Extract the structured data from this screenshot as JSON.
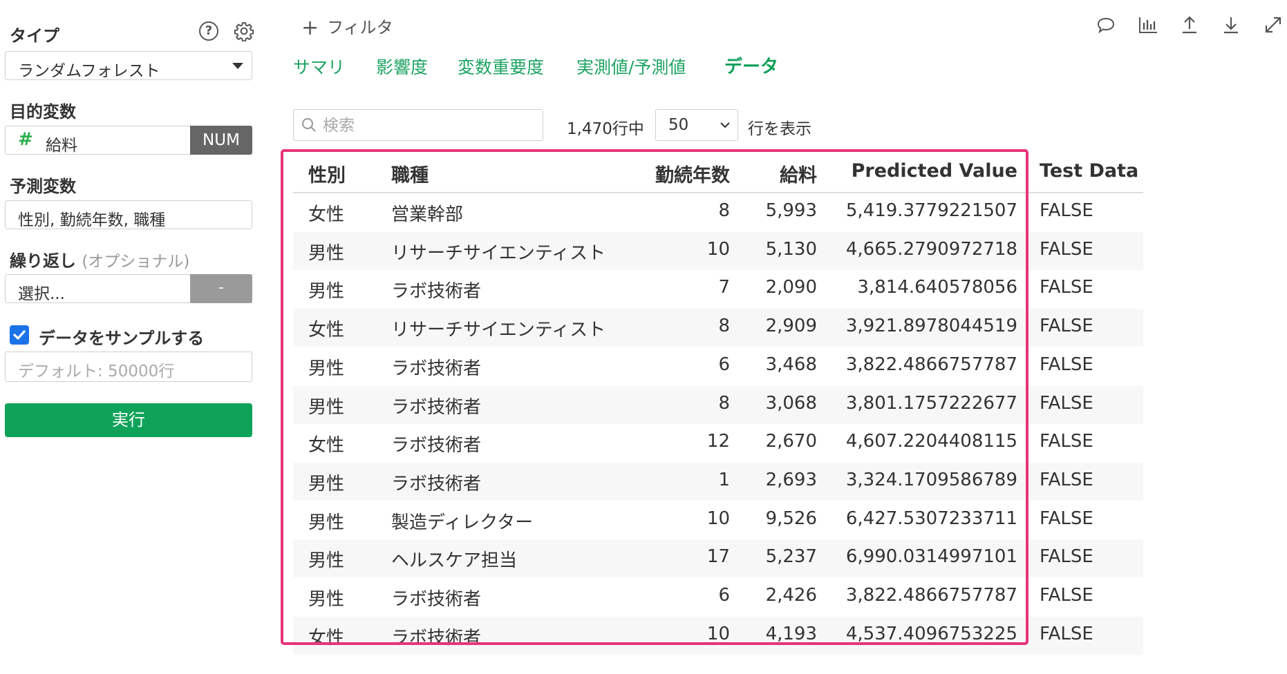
{
  "sidebar": {
    "type_label": "タイプ",
    "type_value": "ランダムフォレスト",
    "target_label": "目的変数",
    "target_value": "給料",
    "target_type_badge": "NUM",
    "predictors_label": "予測変数",
    "predictors_value": "性別, 勤続年数, 職種",
    "repeat_label": "繰り返し",
    "repeat_optional": "(オプショナル)",
    "repeat_value": "選択...",
    "repeat_button": "-",
    "sample_label": "データをサンプルする",
    "sample_checked": true,
    "sample_placeholder": "デフォルト: 50000行",
    "run_label": "実行"
  },
  "toolbar": {
    "filter_label": "フィルタ",
    "icons": [
      "comment-icon",
      "chart-icon",
      "upload-icon",
      "download-icon",
      "expand-icon"
    ]
  },
  "tabs": [
    {
      "label": "サマリ",
      "active": false
    },
    {
      "label": "影響度",
      "active": false
    },
    {
      "label": "変数重要度",
      "active": false
    },
    {
      "label": "実測値/予測値",
      "active": false
    },
    {
      "label": "データ",
      "active": true
    }
  ],
  "data_view": {
    "search_placeholder": "検索",
    "row_count": "1,470行中",
    "page_size": "50",
    "rows_suffix": "行を表示"
  },
  "table": {
    "columns": [
      "性別",
      "職種",
      "勤続年数",
      "給料",
      "Predicted Value",
      "Test Data"
    ],
    "rows": [
      [
        "女性",
        "営業幹部",
        "8",
        "5,993",
        "5,419.3779221507",
        "FALSE"
      ],
      [
        "男性",
        "リサーチサイエンティスト",
        "10",
        "5,130",
        "4,665.2790972718",
        "FALSE"
      ],
      [
        "男性",
        "ラボ技術者",
        "7",
        "2,090",
        "3,814.640578056",
        "FALSE"
      ],
      [
        "女性",
        "リサーチサイエンティスト",
        "8",
        "2,909",
        "3,921.8978044519",
        "FALSE"
      ],
      [
        "男性",
        "ラボ技術者",
        "6",
        "3,468",
        "3,822.4866757787",
        "FALSE"
      ],
      [
        "男性",
        "ラボ技術者",
        "8",
        "3,068",
        "3,801.1757222677",
        "FALSE"
      ],
      [
        "女性",
        "ラボ技術者",
        "12",
        "2,670",
        "4,607.2204408115",
        "FALSE"
      ],
      [
        "男性",
        "ラボ技術者",
        "1",
        "2,693",
        "3,324.1709586789",
        "FALSE"
      ],
      [
        "男性",
        "製造ディレクター",
        "10",
        "9,526",
        "6,427.5307233711",
        "FALSE"
      ],
      [
        "男性",
        "ヘルスケア担当",
        "17",
        "5,237",
        "6,990.0314997101",
        "FALSE"
      ],
      [
        "男性",
        "ラボ技術者",
        "6",
        "2,426",
        "3,822.4866757787",
        "FALSE"
      ],
      [
        "女性",
        "ラボ技術者",
        "10",
        "4,193",
        "4,537.4096753225",
        "FALSE"
      ]
    ]
  },
  "colors": {
    "accent_green": "#1da362",
    "run_button": "#0fa35a",
    "highlight_border": "#e8337a",
    "checkbox_blue": "#1a73e8"
  }
}
